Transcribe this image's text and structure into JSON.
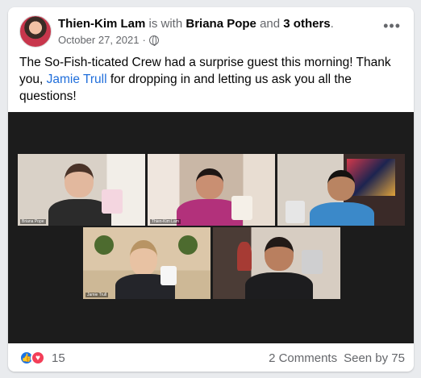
{
  "post": {
    "author": "Thien-Kim Lam",
    "with_text": "is with",
    "tagged_person": "Briana Pope",
    "and_text": "and",
    "others": "3 others",
    "period": ".",
    "date": "October 27, 2021",
    "separator": "·",
    "text_before_link": "The So-Fish-ticated Crew had a surprise guest this morning! Thank you,",
    "link_text": "Jamie Trull",
    "text_after_link": "for dropping in and letting us ask you all the questions!",
    "more_glyph": "•••"
  },
  "video_tiles": [
    {
      "label": "Briana Pope"
    },
    {
      "label": "Thien-Kim Lam"
    },
    {
      "label": ""
    },
    {
      "label": "Jamie Trull"
    },
    {
      "label": ""
    }
  ],
  "footer": {
    "like_glyph": "👍",
    "love_glyph": "♥",
    "reaction_count": "15",
    "comments": "2 Comments",
    "seen_by": "Seen by 75"
  },
  "colors": {
    "link": "#216fdb",
    "like": "#1b74e4",
    "love": "#f33e58"
  }
}
